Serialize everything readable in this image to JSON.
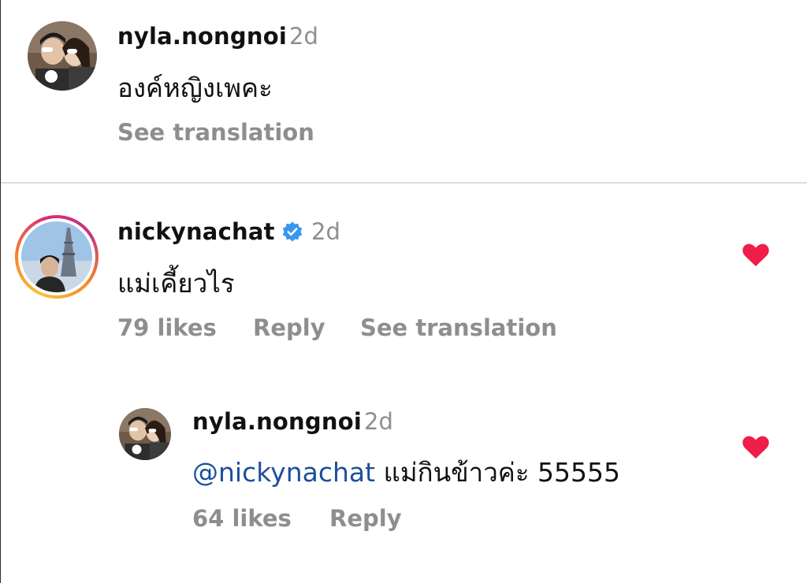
{
  "comments": [
    {
      "username": "nyla.nongnoi",
      "time": "2d",
      "text": "องค์หญิงเพคะ",
      "see_translation": "See translation"
    },
    {
      "username": "nickynachat",
      "verified": true,
      "time": "2d",
      "text": "แม่เคี้ยวไร",
      "likes": "79 likes",
      "reply": "Reply",
      "see_translation": "See translation",
      "liked": true,
      "heart_color": "#ee1d4a"
    }
  ],
  "reply": {
    "username": "nyla.nongnoi",
    "time": "2d",
    "mention": "@nickynachat",
    "text": "แม่กินข้าวค่ะ 55555",
    "likes": "64 likes",
    "reply": "Reply",
    "liked": true,
    "heart_color": "#ee1d4a"
  },
  "colors": {
    "verified_badge": "#3797f0",
    "mention": "#1d4f9c",
    "secondary_text": "#8e8e8e"
  }
}
